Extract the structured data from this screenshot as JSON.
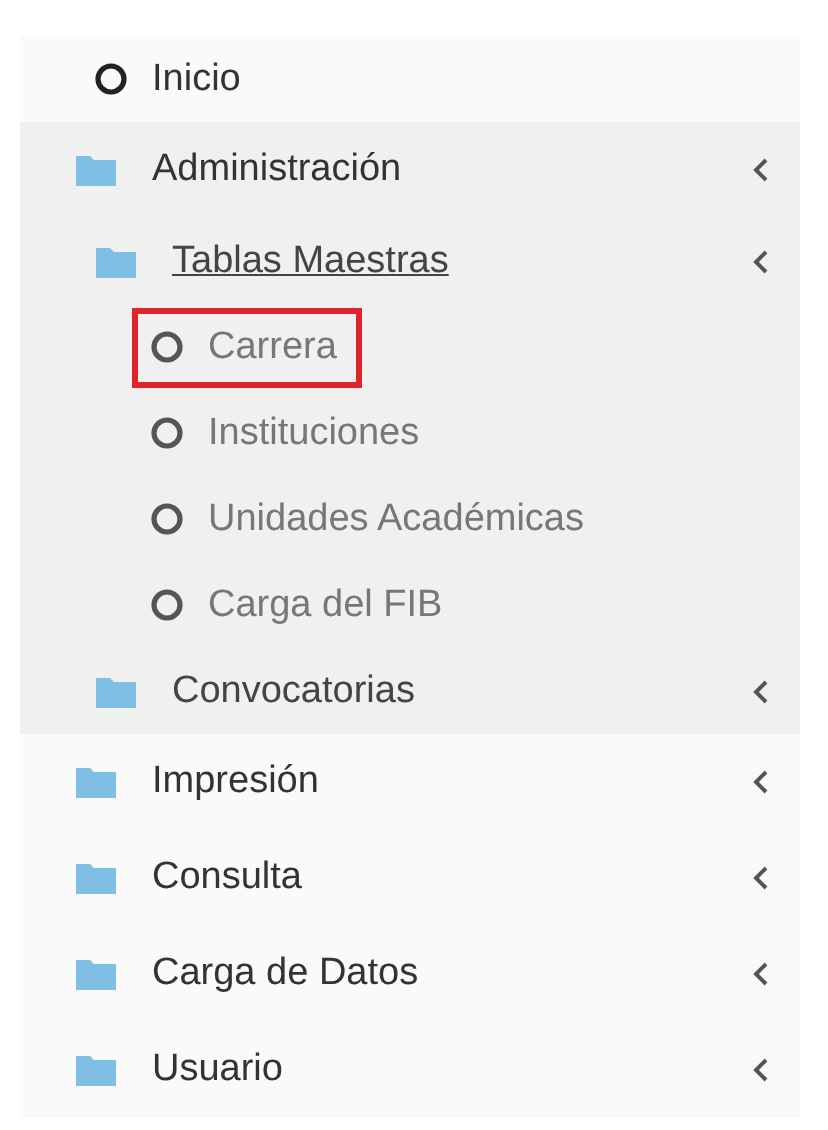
{
  "menu": [
    {
      "kind": "link",
      "label": "Inicio",
      "selected": false
    },
    {
      "kind": "folder",
      "label": "Administración",
      "active": false,
      "children": [
        {
          "kind": "folder",
          "label": "Tablas Maestras",
          "active": true,
          "children": [
            {
              "kind": "link",
              "label": "Carrera",
              "selected": true
            },
            {
              "kind": "link",
              "label": "Instituciones",
              "selected": false
            },
            {
              "kind": "link",
              "label": "Unidades Académicas",
              "selected": false
            },
            {
              "kind": "link",
              "label": "Carga del FIB",
              "selected": false
            }
          ]
        },
        {
          "kind": "folder",
          "label": "Convocatorias",
          "active": false
        }
      ]
    },
    {
      "kind": "folder",
      "label": "Impresión",
      "active": false
    },
    {
      "kind": "folder",
      "label": "Consulta",
      "active": false
    },
    {
      "kind": "folder",
      "label": "Carga de Datos",
      "active": false
    },
    {
      "kind": "folder",
      "label": "Usuario",
      "active": false
    }
  ]
}
